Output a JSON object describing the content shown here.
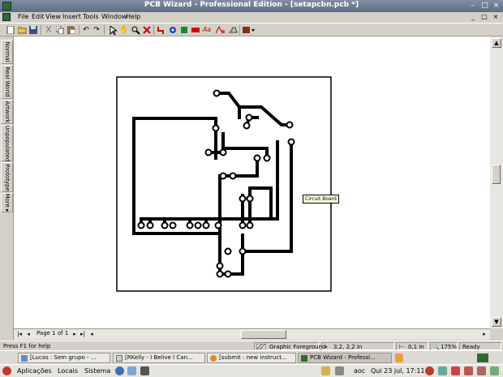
{
  "window": {
    "title": "PCB Wizard - Professional Edition - [setapcbn.pcb *]",
    "controls": {
      "minimize": "–",
      "maximize": "□",
      "close": "×"
    },
    "mdi_controls": {
      "minimize": "_",
      "restore": "□",
      "close": "×"
    }
  },
  "menu": [
    "File",
    "Edit",
    "View",
    "Insert",
    "Tools",
    "Window",
    "Help"
  ],
  "toolbar": {
    "icons": [
      "new-icon",
      "open-icon",
      "save-icon",
      "print-icon",
      "cut-icon",
      "copy-icon",
      "paste-icon",
      "undo-icon",
      "redo-icon",
      "select-arrow-icon",
      "hand-icon",
      "zoom-icon",
      "delete-icon",
      "track-icon",
      "pad-round-icon",
      "pad-square-icon",
      "pad-smd-icon",
      "text-icon",
      "text-style-icon",
      "drill-icon",
      "copper-icon"
    ],
    "text_glyph": "Aa"
  },
  "sidetabs": [
    "Normal",
    "Real World",
    "Artwork",
    "Unpopulated",
    "Prototype",
    "More ▸"
  ],
  "canvas": {
    "tooltip": "Circuit Board"
  },
  "pager": {
    "page_info": "Page 1 of 1"
  },
  "status": {
    "help": "Press F1 for help",
    "layer": "Graphic Foreground",
    "coords": "3,2, 2,2 in",
    "width": "0,1 in",
    "zoom": "175%",
    "state": "Ready"
  },
  "taskbar": [
    {
      "label": "[Lucas : Sem grupo - ...",
      "active": false,
      "color": "#5b8fc7"
    },
    {
      "label": "[RKelly - I Belive I Can...",
      "active": false,
      "color": "#d0d0d0"
    },
    {
      "label": "[submit : new instruct...",
      "active": false,
      "color": "#e08a2a"
    },
    {
      "label": "PCB Wizard - Professi...",
      "active": true,
      "color": "#2d6b2f"
    }
  ],
  "panel": {
    "menus": [
      "Aplicações",
      "Locais",
      "Sistema"
    ],
    "user": "aoc",
    "clock": "Qui 23 jul, 17:11"
  },
  "colors": {
    "titlebar": "#6a7b93",
    "track": "#000000",
    "board_border": "#000000",
    "tooltip_bg": "#ffffe1"
  }
}
